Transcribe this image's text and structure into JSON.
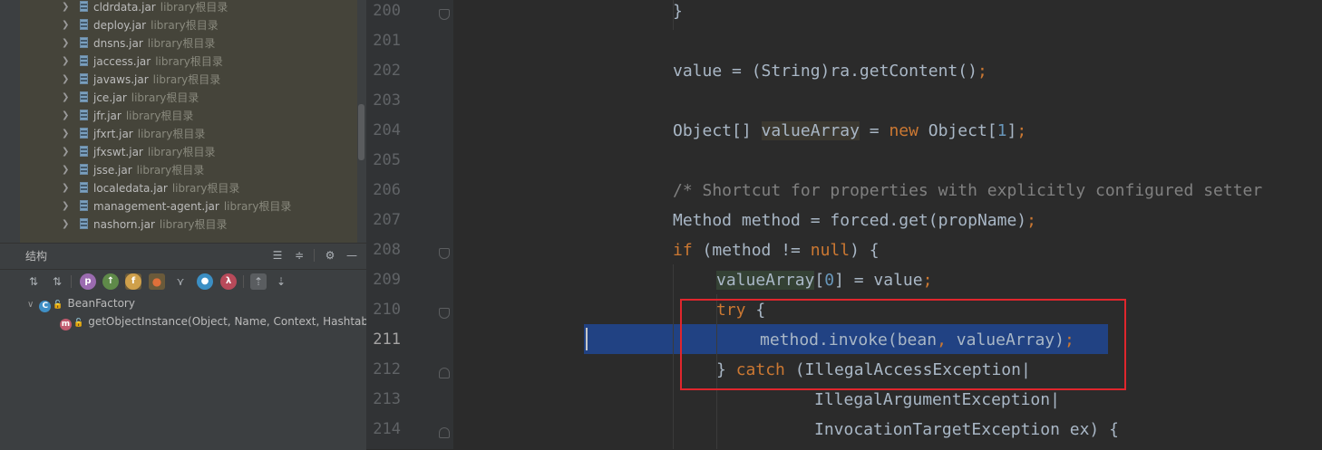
{
  "project_tree": {
    "items": [
      {
        "name": "cldrdata.jar",
        "lib": "library根目录"
      },
      {
        "name": "deploy.jar",
        "lib": "library根目录"
      },
      {
        "name": "dnsns.jar",
        "lib": "library根目录"
      },
      {
        "name": "jaccess.jar",
        "lib": "library根目录"
      },
      {
        "name": "javaws.jar",
        "lib": "library根目录"
      },
      {
        "name": "jce.jar",
        "lib": "library根目录"
      },
      {
        "name": "jfr.jar",
        "lib": "library根目录"
      },
      {
        "name": "jfxrt.jar",
        "lib": "library根目录"
      },
      {
        "name": "jfxswt.jar",
        "lib": "library根目录"
      },
      {
        "name": "jsse.jar",
        "lib": "library根目录"
      },
      {
        "name": "localedata.jar",
        "lib": "library根目录"
      },
      {
        "name": "management-agent.jar",
        "lib": "library根目录"
      },
      {
        "name": "nashorn.jar",
        "lib": "library根目录"
      }
    ]
  },
  "structure": {
    "title": "结构",
    "toolbar_icons": [
      "sort-alpha-icon",
      "sort-visibility-icon",
      "properties-icon",
      "inherited-icon",
      "fields-icon",
      "non-public-icon",
      "anonymous-icon",
      "lambda-filter-icon",
      "lambda-icon",
      "scroll-to-source-icon",
      "scroll-from-source-icon"
    ],
    "tree": {
      "class_badge": "C",
      "class_name": "BeanFactory",
      "method_badge": "m",
      "method_sig": "getObjectInstance(Object, Name, Context, Hashtable"
    }
  },
  "editor": {
    "current_line": "211",
    "lines": [
      {
        "no": "200"
      },
      {
        "no": "201"
      },
      {
        "no": "202"
      },
      {
        "no": "203"
      },
      {
        "no": "204"
      },
      {
        "no": "205"
      },
      {
        "no": "206"
      },
      {
        "no": "207"
      },
      {
        "no": "208"
      },
      {
        "no": "209"
      },
      {
        "no": "210"
      },
      {
        "no": "211"
      },
      {
        "no": "212"
      },
      {
        "no": "213"
      },
      {
        "no": "214"
      }
    ],
    "tokens": {
      "l200": "}",
      "l202a": "value = (String)ra.getContent()",
      "l202b": ";",
      "l204a": "Object[] ",
      "l204b": "valueArray",
      "l204c": " = ",
      "l204d": "new",
      "l204e": " Object[",
      "l204f": "1",
      "l204g": "]",
      "l204h": ";",
      "l206": "/* Shortcut for properties with explicitly configured setter",
      "l207a": "Method method = forced.get(propName)",
      "l207b": ";",
      "l208a": "if",
      "l208b": " (method != ",
      "l208c": "null",
      "l208d": ") {",
      "l209a": "valueArray",
      "l209b": "[",
      "l209c": "0",
      "l209d": "] = value",
      "l209e": ";",
      "l210a": "try",
      "l210b": " {",
      "l211a": "method.invoke(bean",
      "l211b": ", ",
      "l211c": "valueArray)",
      "l211d": ";",
      "l212a": "} ",
      "l212b": "catch",
      "l212c": " (IllegalAccessException|",
      "l213": "IllegalArgumentException|",
      "l214": "InvocationTargetException ex) {"
    }
  }
}
